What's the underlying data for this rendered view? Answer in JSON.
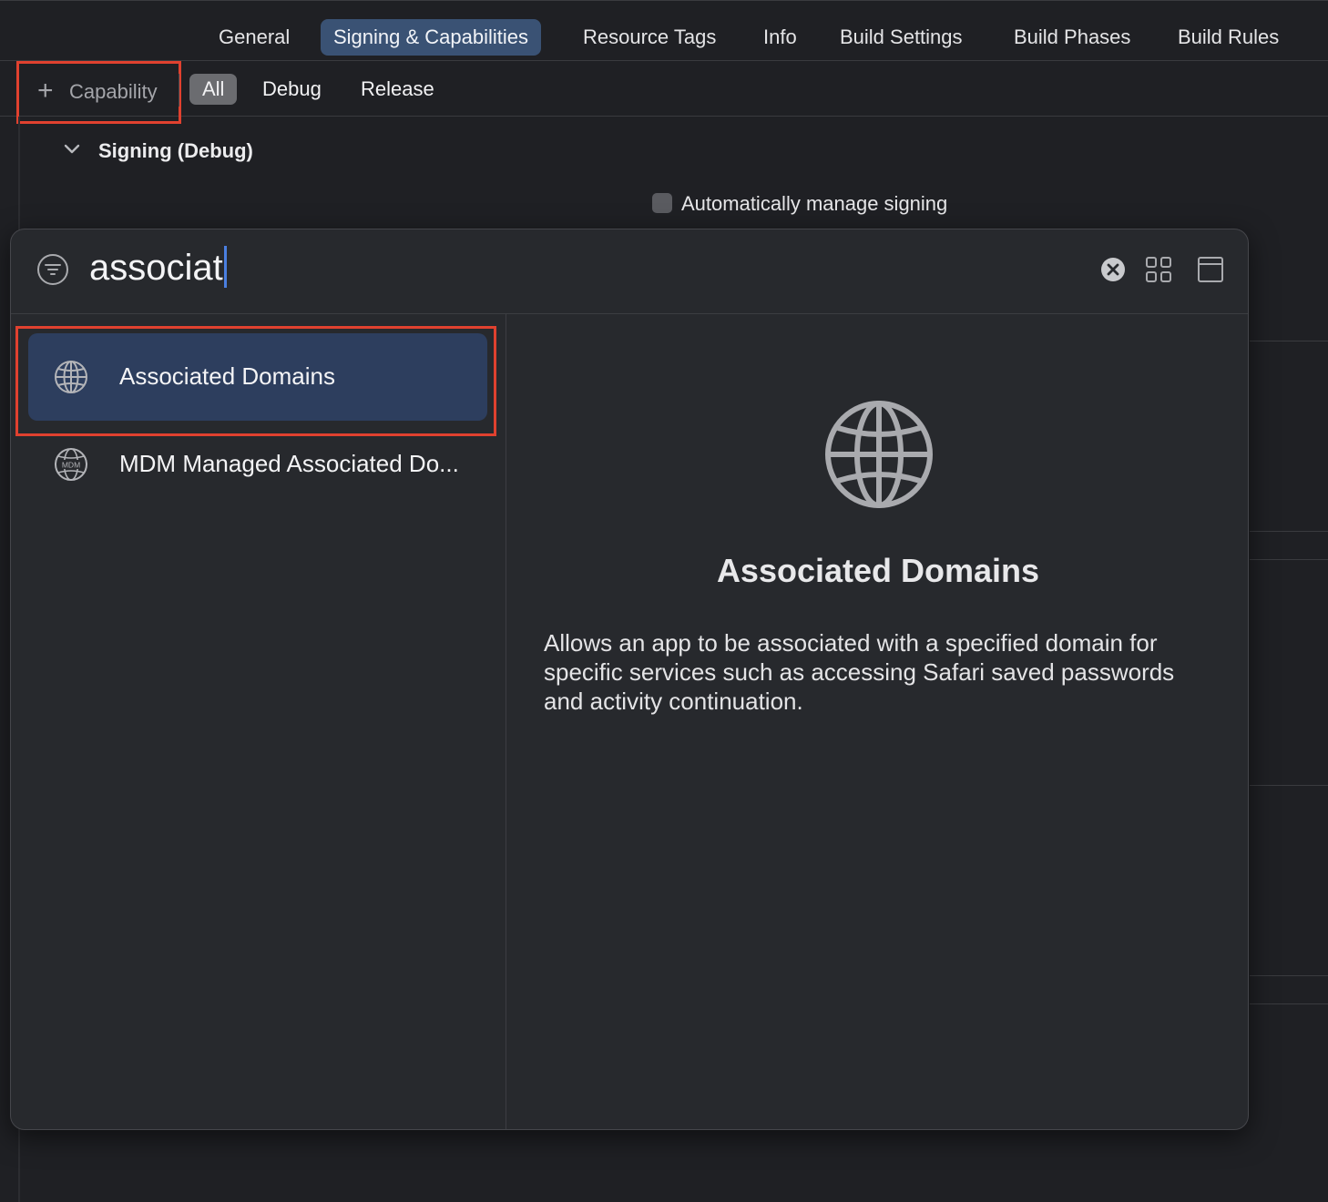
{
  "tabs": {
    "general": "General",
    "signing": "Signing & Capabilities",
    "resource_tags": "Resource Tags",
    "info": "Info",
    "build_settings": "Build Settings",
    "build_phases": "Build Phases",
    "build_rules": "Build Rules",
    "active": "Signing & Capabilities"
  },
  "filterbar": {
    "add_capability_label": "Capability",
    "segments": {
      "all": "All",
      "debug": "Debug",
      "release": "Release"
    },
    "active_segment": "All"
  },
  "signing": {
    "section_title": "Signing (Debug)",
    "auto_manage_label": "Automatically manage signing"
  },
  "library": {
    "search_value": "associat",
    "results": [
      {
        "name": "Associated Domains",
        "icon": "globe-icon",
        "selected": true
      },
      {
        "name": "MDM Managed Associated Do...",
        "icon": "mdm-globe-icon",
        "selected": false
      }
    ],
    "detail": {
      "icon": "globe-icon",
      "title": "Associated Domains",
      "description": "Allows an app to be associated with a specified domain for specific services such as accessing Safari saved passwords and activity continuation."
    }
  },
  "colors": {
    "background": "#1f2024",
    "active_tab": "#3a5274",
    "selected_row": "#2d3e5e",
    "highlight_box": "#e0412f"
  }
}
